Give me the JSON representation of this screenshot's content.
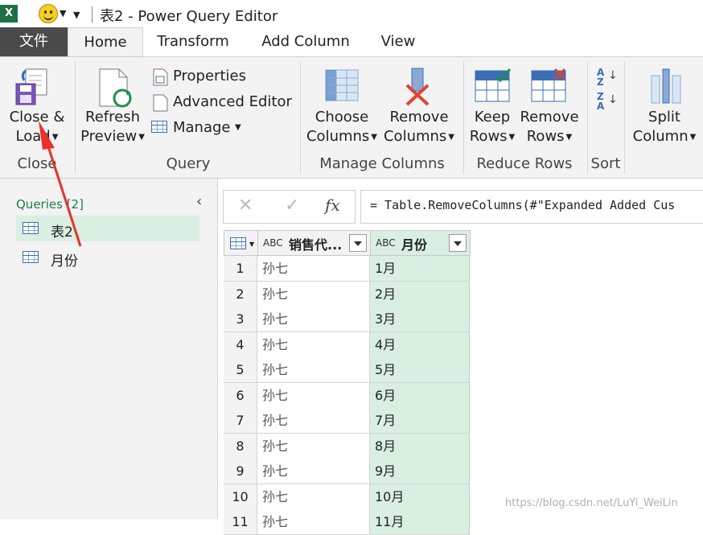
{
  "window": {
    "title": "表2 - Power Query Editor"
  },
  "quick_access": {
    "app_icon": "excel-icon",
    "feedback_icon": "smiley-icon"
  },
  "tabs": [
    "文件",
    "Home",
    "Transform",
    "Add Column",
    "View"
  ],
  "ribbon": {
    "close": {
      "label_line1": "Close &",
      "label_line2": "Load",
      "group": "Close"
    },
    "query": {
      "refresh_line1": "Refresh",
      "refresh_line2": "Preview",
      "properties": "Properties",
      "advanced_editor": "Advanced Editor",
      "manage": "Manage",
      "group": "Query"
    },
    "manage_columns": {
      "choose_line1": "Choose",
      "choose_line2": "Columns",
      "remove_line1": "Remove",
      "remove_line2": "Columns",
      "group": "Manage Columns"
    },
    "reduce_rows": {
      "keep_line1": "Keep",
      "keep_line2": "Rows",
      "remove_line1": "Remove",
      "remove_line2": "Rows",
      "group": "Reduce Rows"
    },
    "sort": {
      "az": "A Z",
      "za": "Z A",
      "group": "Sort"
    },
    "split": {
      "line1": "Split",
      "line2": "Column"
    }
  },
  "queries_pane": {
    "header": "Queries [2]",
    "items": [
      {
        "label": "表2"
      },
      {
        "label": "月份"
      }
    ]
  },
  "formula_bar": {
    "cancel": "✕",
    "confirm": "✓",
    "fx": "fx",
    "formula": "= Table.RemoveColumns(#\"Expanded Added Cus"
  },
  "grid": {
    "type_badge": "ABC",
    "columns": [
      {
        "name": "销售代..."
      },
      {
        "name": "月份"
      }
    ],
    "rows": [
      [
        "1",
        "孙七",
        "1月"
      ],
      [
        "2",
        "孙七",
        "2月"
      ],
      [
        "3",
        "孙七",
        "3月"
      ],
      [
        "4",
        "孙七",
        "4月"
      ],
      [
        "5",
        "孙七",
        "5月"
      ],
      [
        "6",
        "孙七",
        "6月"
      ],
      [
        "7",
        "孙七",
        "7月"
      ],
      [
        "8",
        "孙七",
        "8月"
      ],
      [
        "9",
        "孙七",
        "9月"
      ],
      [
        "10",
        "孙七",
        "10月"
      ],
      [
        "11",
        "孙七",
        "11月"
      ]
    ]
  },
  "watermark": "https://blog.csdn.net/LuYi_WeiLin",
  "colors": {
    "accent_green": "#d9efe2",
    "file_tab": "#4a4a4a",
    "annotation_arrow": "#e8322b"
  }
}
